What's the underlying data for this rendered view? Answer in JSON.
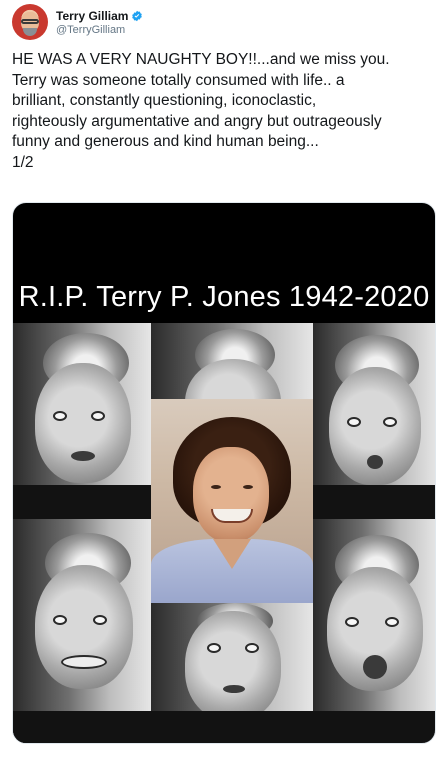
{
  "author": {
    "display_name": "Terry Gilliam",
    "handle": "@TerryGilliam",
    "verified": true,
    "avatar_icon": "user-avatar",
    "verified_icon": "verified-badge-icon",
    "verified_color": "#1da1f2"
  },
  "tweet": {
    "lines": [
      "HE WAS A VERY NAUGHTY BOY!!...and we miss you.",
      "Terry was someone totally consumed with life.. a",
      "brilliant, constantly questioning, iconoclastic,",
      "righteously argumentative and angry but outrageously",
      "funny and generous and kind human being...",
      "1/2"
    ]
  },
  "media": {
    "caption": "R.I.P. Terry P. Jones 1942-2020",
    "background": "#000000"
  }
}
